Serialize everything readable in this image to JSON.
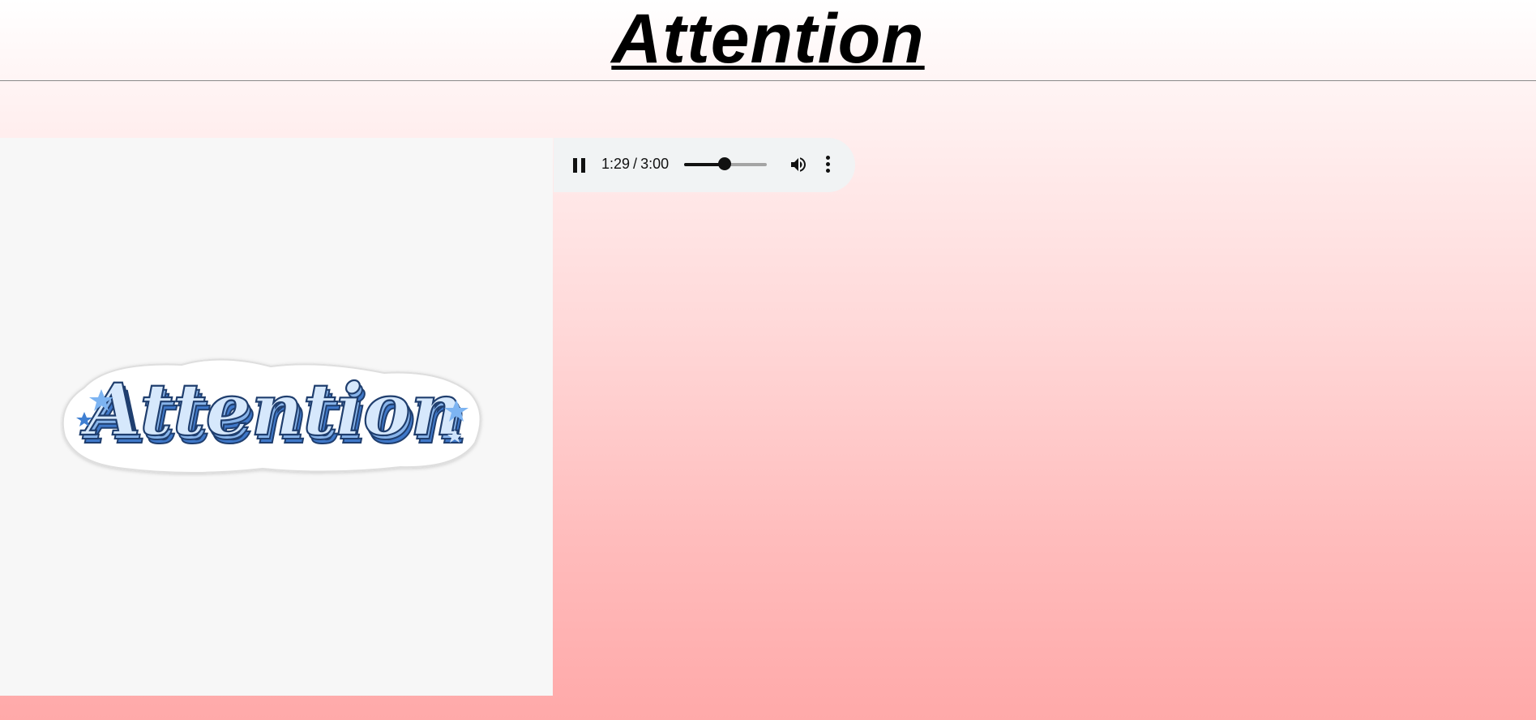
{
  "header": {
    "title": "Attention"
  },
  "artwork": {
    "sticker_text": "Attention",
    "colors": {
      "letter_fill": "#cfe4fb",
      "letter_shadow": "#5b8ed6",
      "letter_outline": "#1f3e6e",
      "star_light": "#7db4f2",
      "star_dark": "#3f7fd2"
    }
  },
  "player": {
    "state": "playing",
    "control_icon": "pause-icon",
    "current_time": "1:29",
    "separator": "/",
    "duration": "3:00",
    "progress_fraction": 0.494,
    "volume_icon": "volume-icon",
    "menu_icon": "more-vert-icon"
  },
  "colors": {
    "title_color": "#000000",
    "player_background": "#f1f3f4",
    "gradient_top": "#ffffff",
    "gradient_bottom": "#ffa9a9"
  }
}
